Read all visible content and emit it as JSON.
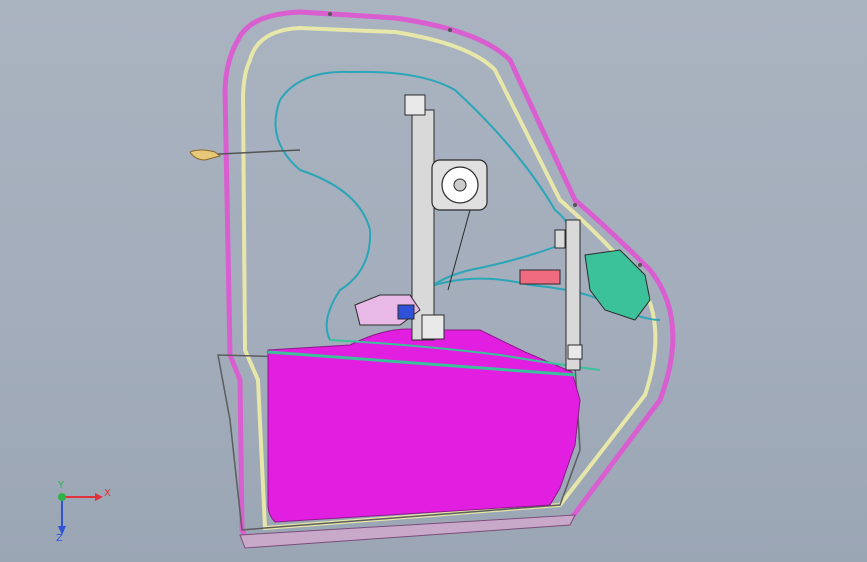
{
  "viewport": {
    "background": "#a7b0be"
  },
  "model": {
    "colors": {
      "frame_outer": "#d95fd0",
      "frame_inner": "#e6e7a8",
      "glass": "#e21fe0",
      "wiring": "#2aa6b8",
      "mechanism": "#d9d9d9",
      "motor_assembly": "#3bc29a",
      "outline": "#2b2b2b"
    }
  },
  "triad": {
    "x_label": "X",
    "y_label": "Y",
    "z_label": "Z",
    "colors": {
      "x": "#e0323b",
      "y": "#2db34a",
      "z": "#3052d8"
    }
  }
}
